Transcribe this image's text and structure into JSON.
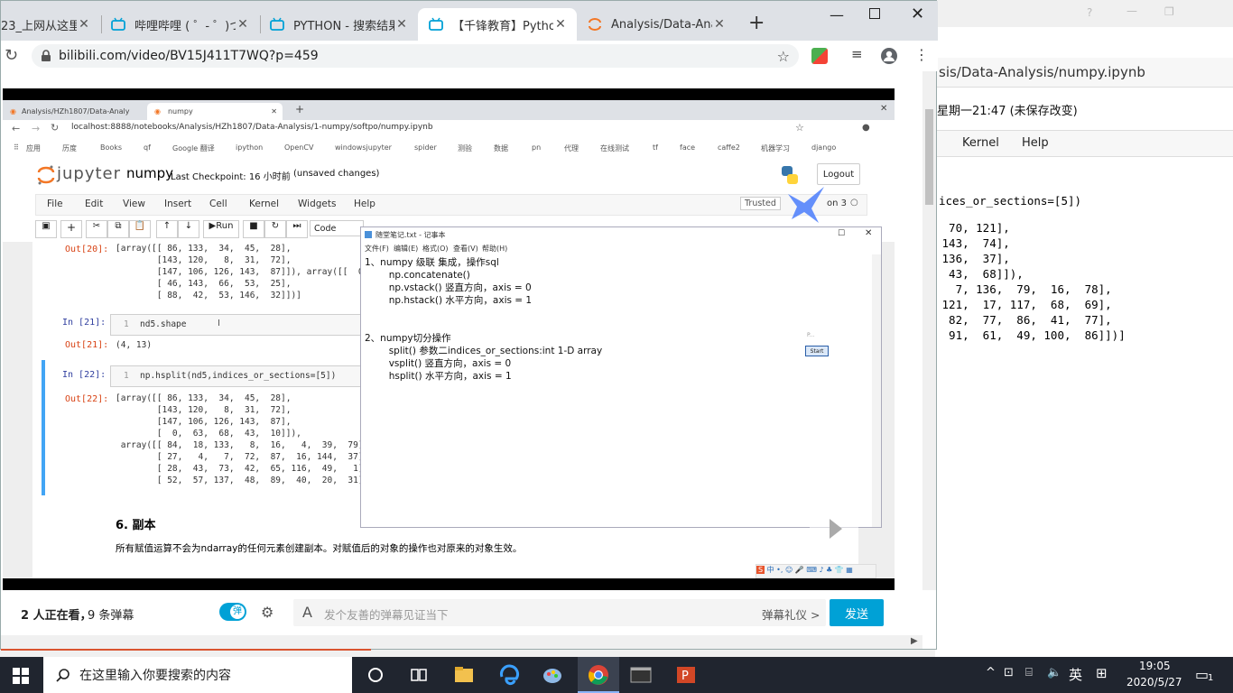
{
  "back_window": {
    "title_controls": [
      "?",
      "—",
      "❐"
    ],
    "path_fragment": "sis/Data-Analysis/numpy.ipynb",
    "checkpoint_fragment": "星期一21:47 (未保存改变)",
    "menu": [
      "Kernel",
      "Help"
    ],
    "code_lines": [
      "ices_or_sections=[5])",
      "  70, 121],",
      " 143,  74],",
      " 136,  37],",
      "  43,  68]]),",
      "   7, 136,  79,  16,  78],",
      " 121,  17, 117,  68,  69],",
      "  82,  77,  86,  41,  77],",
      "  91,  61,  49, 100,  86]])]"
    ]
  },
  "browser": {
    "tabs": [
      {
        "title": "23_上网从这里"
      },
      {
        "title": "哔哩哔哩 ( ゜- ゜)つロ"
      },
      {
        "title": "PYTHON - 搜索结果"
      },
      {
        "title": "【千锋教育】Python"
      },
      {
        "title": "Analysis/Data-Anal"
      }
    ],
    "new_tab": "+",
    "url": "bilibili.com/video/BV15J411T7WQ?p=459"
  },
  "inner_browser": {
    "tabs": [
      "Analysis/HZh1807/Data-Analy",
      "numpy"
    ],
    "url": "localhost:8888/notebooks/Analysis/HZh1807/Data-Analysis/1-numpy/softpo/numpy.ipynb",
    "bookmarks": [
      "应用",
      "历度",
      "Books",
      "qf",
      "Google 翻译",
      "ipython",
      "OpenCV",
      "windowsjupyter",
      "spider",
      "测验",
      "数据",
      "pn",
      "代理",
      "在线测试",
      "tf",
      "face",
      "caffe2",
      "机器学习",
      "django"
    ]
  },
  "jupyter": {
    "logo_text": "jupyter",
    "notebook_name": "numpy",
    "checkpoint": "Last Checkpoint: 16 小时前",
    "unsaved": "(unsaved changes)",
    "logout": "Logout",
    "menu": [
      "File",
      "Edit",
      "View",
      "Insert",
      "Cell",
      "Kernel",
      "Widgets",
      "Help"
    ],
    "trusted": "Trusted",
    "kernel_name": "on 3",
    "run_label": "Run",
    "cell_type": "Code"
  },
  "notebook": {
    "out20_prompt": "Out[20]:",
    "out20_lines": [
      "[array([[ 86, 133,  34,  45,  28],",
      "        [143, 120,   8,  31,  72],",
      "        [147, 106, 126, 143,  87]]), array([[  0,",
      "        [ 46, 143,  66,  53,  25],",
      "        [ 88,  42,  53, 146,  32]])]"
    ],
    "in21_prompt": "In  [21]:",
    "in21_lineno": "1",
    "in21_code": "nd5.shape",
    "out21_prompt": "Out[21]:",
    "out21_value": "(4, 13)",
    "in22_prompt": "In  [22]:",
    "in22_lineno": "1",
    "in22_code": "np.hsplit(nd5,indices_or_sections=[5])",
    "out22_prompt": "Out[22]:",
    "out22_lines": [
      "[array([[ 86, 133,  34,  45,  28],",
      "        [143, 120,   8,  31,  72],",
      "        [147, 106, 126, 143,  87],",
      "        [  0,  63,  68,  43,  10]]),",
      " array([[ 84,  18, 133,   8,  16,   4,  39,  79],",
      "        [ 27,   4,   7,  72,  87,  16, 144,  37],",
      "        [ 28,  43,  73,  42,  65, 116,  49,   1],",
      "        [ 52,  57, 137,  48,  89,  40,  20,  31]"
    ],
    "section_heading": "6. 副本",
    "section_text": "所有赋值运算不会为ndarray的任何元素创建副本。对赋值后的对象的操作也对原来的对象生效。"
  },
  "notepad": {
    "title": "随堂笔记.txt - 记事本",
    "menu": [
      "文件(F)",
      "编辑(E)",
      "格式(O)",
      "查看(V)",
      "帮助(H)"
    ],
    "lines": [
      "1、numpy 级联 集成，操作sql",
      "        np.concatenate()",
      "        np.vstack() 竖直方向，axis = 0",
      "        np.hstack() 水平方向，axis = 1",
      "",
      "",
      "2、numpy切分操作",
      "        split() 参数二indices_or_sections:int 1-D array",
      "        vsplit() 竖直方向，axis = 0",
      "        hsplit() 水平方向，axis = 1"
    ],
    "side_widget": "P...",
    "start_button": "Start"
  },
  "bilibili": {
    "viewers": "2 人正在看，",
    "danmaku_count": "9 条弹幕",
    "danmaku_toggle": "弹",
    "placeholder": "发个友善的弹幕见证当下",
    "etiquette": "弹幕礼仪 >",
    "send": "发送"
  },
  "taskbar": {
    "search_placeholder": "在这里输入你要搜索的内容",
    "time": "19:05",
    "date": "2020/5/27",
    "ime": "英",
    "notification_count": "1"
  },
  "colors": {
    "accent_blue": "#00a1d6",
    "jupyter_orange": "#f37726",
    "taskbar": "#20252f"
  }
}
